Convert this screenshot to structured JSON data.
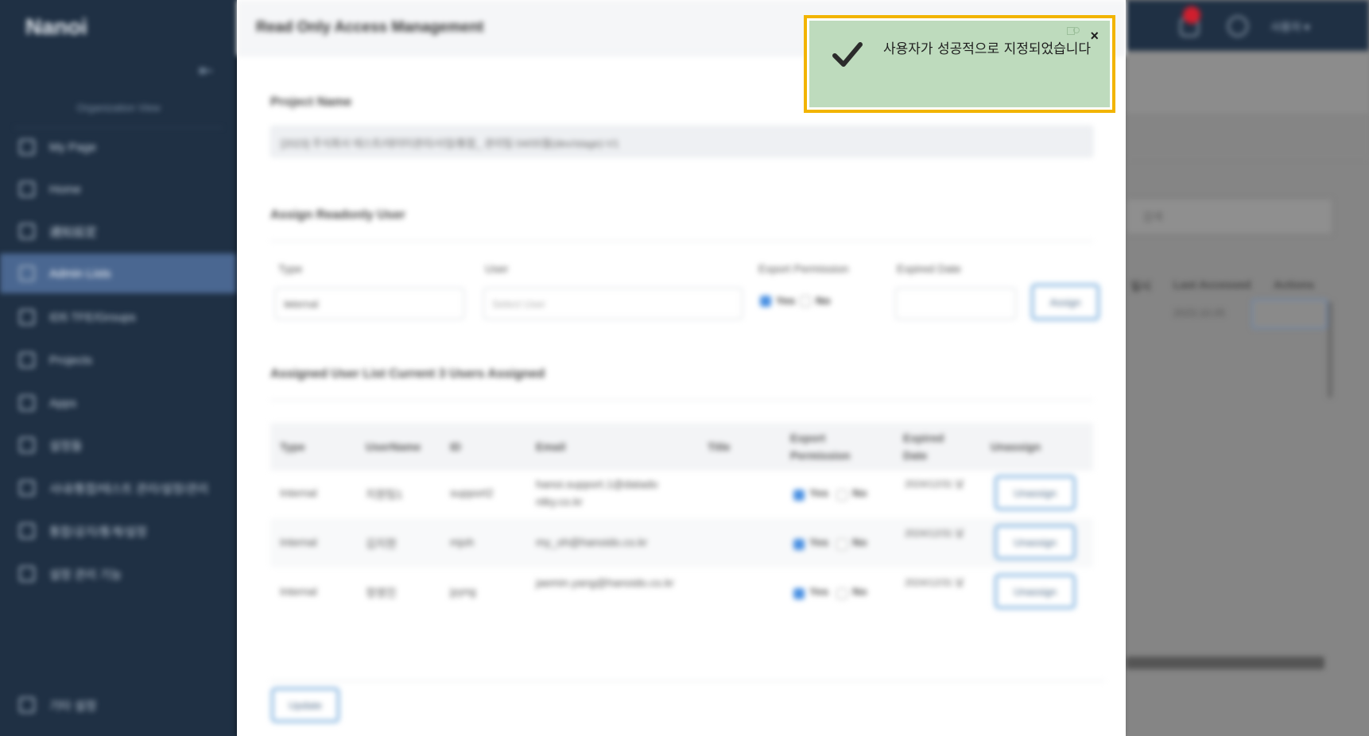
{
  "app": {
    "logo": "Nanoi",
    "org_label": "Organization View"
  },
  "sidebar": {
    "items": [
      {
        "label": "My Page"
      },
      {
        "label": "Home"
      },
      {
        "label": "通知設定"
      },
      {
        "label": "Admin Lists"
      },
      {
        "label": "ID5 TFE/Groups"
      },
      {
        "label": "Projects"
      },
      {
        "label": "Apps"
      },
      {
        "label": "설정들"
      },
      {
        "label": "사내/통합/테스트 관리/설정/관리"
      },
      {
        "label": "통합/공지/통계/설정"
      },
      {
        "label": "설정 관리 기능"
      }
    ],
    "footer_item": {
      "label": "기타 설정"
    }
  },
  "modal": {
    "title": "Read Only Access Management",
    "project_name_label": "Project Name",
    "project_name_value": "[2023] 주식회사 테스트/데이터관리/사업/통합_ 관리팀 04/05월(dev/stage)-V1",
    "assign_section_title": "Assign Readonly User",
    "type_label": "Type",
    "type_value": "Internal",
    "user_label": "User",
    "user_placeholder": "Select User",
    "export_label": "Export Permission",
    "expired_label": "Expired Date",
    "assign_button": "Assign",
    "yes_label": "Yes",
    "no_label": "No",
    "assigned_title": "Assigned User List Current 3 Users Assigned",
    "columns": [
      "Type",
      "UserName",
      "ID",
      "Email",
      "Title",
      "Export Permission",
      "Expired Date",
      "Unassign"
    ],
    "rows": [
      {
        "type": "Internal",
        "username": "지원팀1",
        "id": "support2",
        "email": "hanoi.support.1@datado ntky.co.kr",
        "title": "",
        "expired": "2024/12/31 날",
        "action": "Unassign"
      },
      {
        "type": "Internal",
        "username": "김지현",
        "id": "mjoh",
        "email": "my_oh@hanoido.co.kr",
        "title": "",
        "expired": "2024/12/31 날",
        "action": "Unassign"
      },
      {
        "type": "Internal",
        "username": "정영진",
        "id": "jyyng",
        "email": "jaemin.yang@hanoido.co.kr",
        "title": "",
        "expired": "2024/12/31 날",
        "action": "Unassign"
      }
    ],
    "update_button": "Update"
  },
  "background": {
    "user_menu": "사용자 ▾",
    "search_value": "검색",
    "header_cols": [
      "일시",
      "Last Accessed",
      "Actions"
    ],
    "cell_value": "2023.10.05"
  },
  "toast": {
    "message": "사용자가 성공적으로 지정되었습니다",
    "close": "×"
  }
}
